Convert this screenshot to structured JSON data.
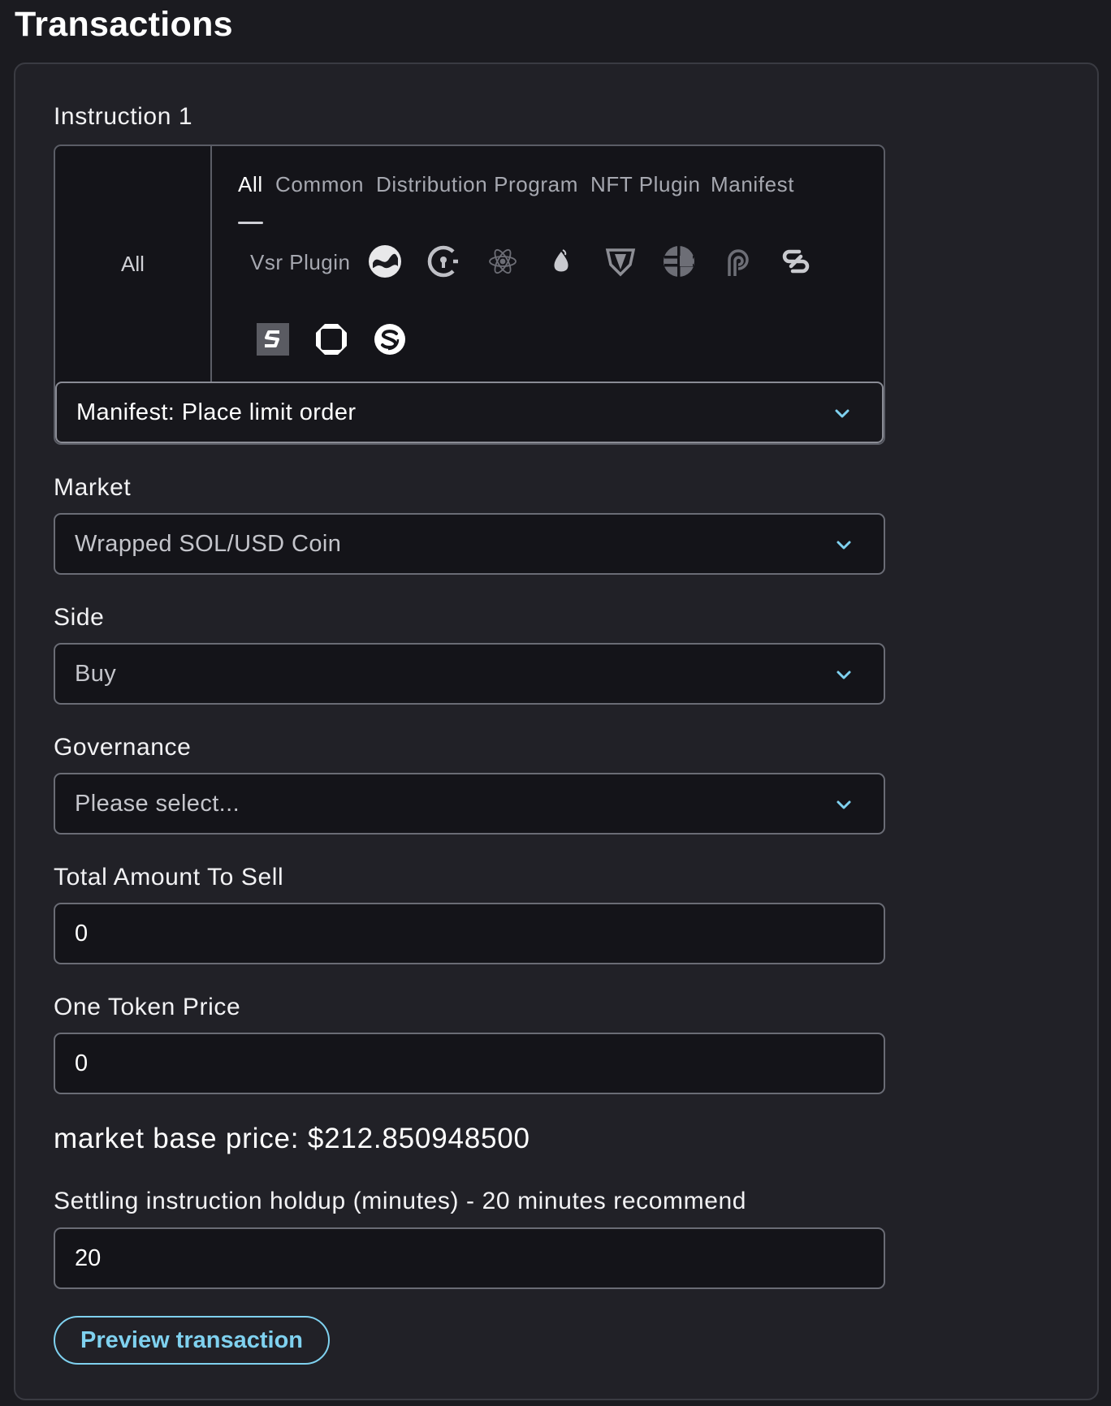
{
  "header": {
    "title": "Transactions"
  },
  "instruction": {
    "label": "Instruction 1",
    "category_left": "All",
    "tabs": [
      {
        "label": "All",
        "active": true
      },
      {
        "label": "Common",
        "active": false
      },
      {
        "label": "Distribution Program",
        "active": false
      },
      {
        "label": "NFT Plugin",
        "active": false
      },
      {
        "label": "Manifest",
        "active": false
      }
    ],
    "extra_tab": "Vsr Plugin",
    "plugin_icons": [
      "wave-logo-icon",
      "lock-logo-icon",
      "atom-logo-icon",
      "drop-logo-icon",
      "shield-logo-icon",
      "globe-logo-icon",
      "p-logo-icon",
      "chain-logo-icon",
      "s-square-logo-icon",
      "octagon-logo-icon",
      "swirl-logo-icon"
    ],
    "selected": "Manifest: Place limit order"
  },
  "market": {
    "label": "Market",
    "value": "Wrapped SOL/USD Coin"
  },
  "side": {
    "label": "Side",
    "value": "Buy"
  },
  "governance": {
    "label": "Governance",
    "placeholder": "Please select..."
  },
  "total_amount": {
    "label": "Total Amount To Sell",
    "value": "0"
  },
  "token_price": {
    "label": "One Token Price",
    "value": "0"
  },
  "market_base_price": "market base price: $212.850948500",
  "holdup": {
    "label": "Settling instruction holdup (minutes) - 20 minutes recommend",
    "value": "20"
  },
  "preview_button": "Preview transaction",
  "colors": {
    "background": "#1b1b20",
    "panel": "#212127",
    "accent": "#7fd1ef",
    "field": "#141419"
  }
}
